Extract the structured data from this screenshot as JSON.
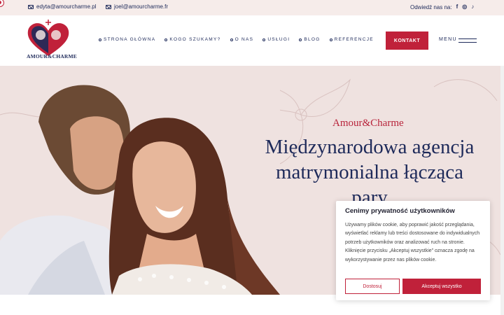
{
  "topbar": {
    "email1": "edyta@amourcharme.pl",
    "email2": "joel@amourcharme.fr",
    "visit_label": "Odwiedź nas na:",
    "social": [
      {
        "icon": "facebook-icon",
        "glyph": "f"
      },
      {
        "icon": "instagram-icon",
        "glyph": "◎"
      },
      {
        "icon": "tiktok-icon",
        "glyph": "♪"
      }
    ]
  },
  "header": {
    "logo_text": "AMOUR&CHARME",
    "nav": [
      {
        "label": "STRONA GŁÓWNA"
      },
      {
        "label": "KOGO SZUKAMY?"
      },
      {
        "label": "O NAS"
      },
      {
        "label": "USŁUGI"
      },
      {
        "label": "BLOG"
      },
      {
        "label": "REFERENCJE"
      }
    ],
    "contact_button": "KONTAKT",
    "menu_label": "MENU"
  },
  "hero": {
    "brand": "Amour&Charme",
    "title": "Międzynarodowa agencja matrymonialna łącząca pary"
  },
  "cookie": {
    "title": "Cenimy prywatność użytkowników",
    "text": "Używamy plików cookie, aby poprawić jakość przeglądania, wyświetlać reklamy lub treści dostosowane do indywidualnych potrzeb użytkowników oraz analizować ruch na stronie. Kliknięcie przycisku „Akceptuj wszystkie” oznacza zgodę na wykorzystywanie przez nas plików cookie.",
    "customize_button": "Dostosuj",
    "accept_button": "Akceptuj wszystko"
  },
  "colors": {
    "navy": "#1e2a5a",
    "accent_red": "#c0213a",
    "topbar_bg": "#f6ecea",
    "hero_bg": "#efe2e0"
  }
}
